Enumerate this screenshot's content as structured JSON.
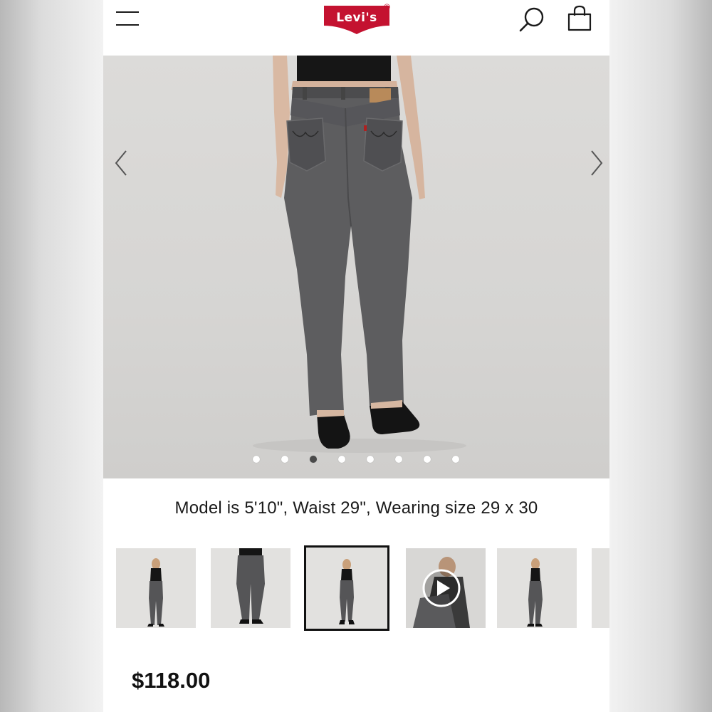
{
  "header": {
    "menu_icon": "hamburger-menu-icon",
    "brand_logo_text": "Levi's",
    "brand_registered_mark": "®",
    "search_icon": "search-icon",
    "bag_icon": "shopping-bag-icon",
    "brand_color": "#c41230"
  },
  "carousel": {
    "prev_icon": "chevron-left-icon",
    "next_icon": "chevron-right-icon",
    "slide_count": 8,
    "active_index": 2
  },
  "product": {
    "model_caption": "Model is 5'10\", Waist 29\", Wearing size 29 x 30",
    "price": "$118.00"
  },
  "thumbnails": {
    "count_visible": 6,
    "selected_index": 2,
    "video_thumb_index": 3,
    "play_icon": "play-icon"
  }
}
